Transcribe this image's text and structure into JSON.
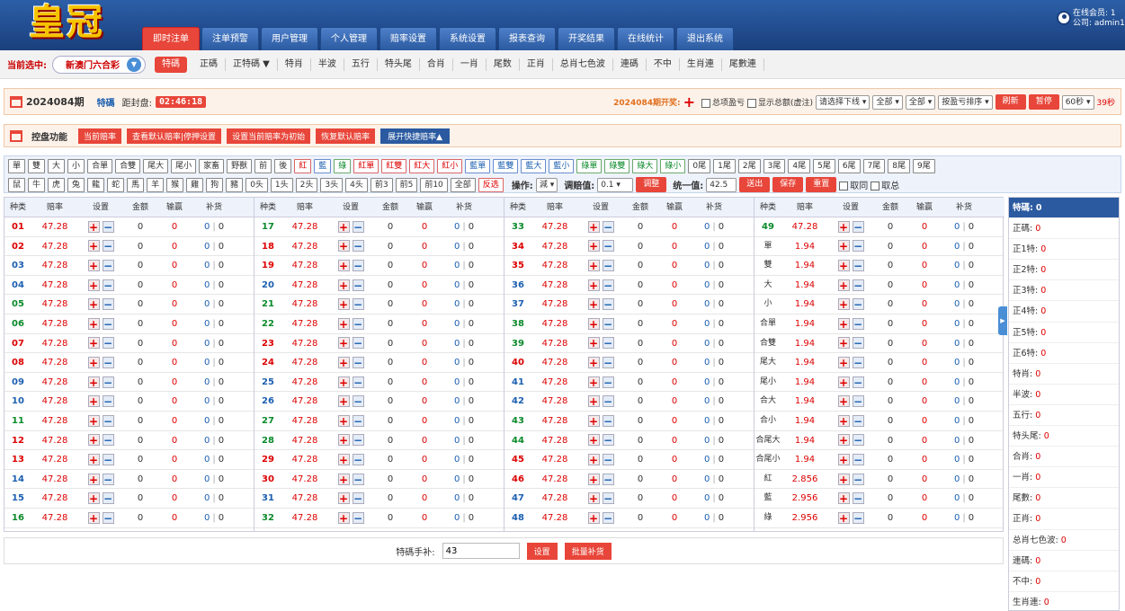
{
  "header": {
    "logo": "皇冠",
    "online_members": "在线会员: 1",
    "company": "公司: admin1",
    "nav": [
      "即时注单",
      "注单预警",
      "用户管理",
      "个人管理",
      "赔率设置",
      "系统设置",
      "报表查询",
      "开奖结果",
      "在线统计",
      "退出系统"
    ]
  },
  "subnav": {
    "current_label": "当前选中:",
    "lottery": "新澳门六合彩",
    "items": [
      "特碼",
      "正碼",
      "正特碼 ▼",
      "特肖",
      "半波",
      "五行",
      "特头尾",
      "合肖",
      "一肖",
      "尾数",
      "正肖",
      "总肖七色波",
      "連碼",
      "不中",
      "生肖連",
      "尾數連"
    ]
  },
  "infobar": {
    "period": "2024084期",
    "type": "特碼",
    "close_label": "距封盘:",
    "countdown": "02:46:18",
    "draw_label": "2024084期开奖:",
    "plus": "+",
    "chk_total": "总项盈亏",
    "chk_show": "显示总额(虚注)",
    "sel_line": "请选择下线",
    "sel_all1": "全部",
    "sel_all2": "全部",
    "sel_sort": "按盈亏排序",
    "refresh": "刷新",
    "pause": "暂停",
    "interval": "60秒",
    "seconds": "39秒"
  },
  "ctlbar": {
    "label": "控盘功能",
    "b1": "当前赔率",
    "b2": "查看默认赔率|停押设置",
    "b3": "设置当前赔率为初始",
    "b4": "恢复默认赔率",
    "b5": "展开快捷赔率▲"
  },
  "quick": {
    "row1": [
      "單",
      "雙",
      "大",
      "小",
      "合單",
      "合雙",
      "尾大",
      "尾小",
      "家畜",
      "野獸",
      "前",
      "後",
      "紅",
      "藍",
      "綠",
      "紅單",
      "紅雙",
      "紅大",
      "紅小",
      "藍單",
      "藍雙",
      "藍大",
      "藍小",
      "綠單",
      "綠雙",
      "綠大",
      "綠小",
      "0尾",
      "1尾",
      "2尾",
      "3尾",
      "4尾",
      "5尾",
      "6尾",
      "7尾",
      "8尾",
      "9尾"
    ],
    "row2": [
      "鼠",
      "牛",
      "虎",
      "兔",
      "龍",
      "蛇",
      "馬",
      "羊",
      "猴",
      "雞",
      "狗",
      "豬",
      "0头",
      "1头",
      "2头",
      "3头",
      "4头",
      "前3",
      "前5",
      "前10",
      "全部",
      "反选"
    ],
    "op_label": "操作:",
    "op": "減",
    "adj_label": "调赔值:",
    "adj": "0.1",
    "adjust": "调整",
    "uni_label": "统一值:",
    "uni": "42.5",
    "send": "送出",
    "save": "保存",
    "reset": "重置",
    "take_same": "取同",
    "take_total": "取总"
  },
  "table": {
    "headers": [
      "种类",
      "赔率",
      "设置",
      "金额",
      "输赢",
      "补货"
    ],
    "plus": "+",
    "minus": "−",
    "sep": "|",
    "columns": [
      [
        {
          "n": "01",
          "o": "47.28",
          "c": "red"
        },
        {
          "n": "02",
          "o": "47.28",
          "c": "red"
        },
        {
          "n": "03",
          "o": "47.28",
          "c": "blue"
        },
        {
          "n": "04",
          "o": "47.28",
          "c": "blue"
        },
        {
          "n": "05",
          "o": "47.28",
          "c": "green"
        },
        {
          "n": "06",
          "o": "47.28",
          "c": "green"
        },
        {
          "n": "07",
          "o": "47.28",
          "c": "red"
        },
        {
          "n": "08",
          "o": "47.28",
          "c": "red"
        },
        {
          "n": "09",
          "o": "47.28",
          "c": "blue"
        },
        {
          "n": "10",
          "o": "47.28",
          "c": "blue"
        },
        {
          "n": "11",
          "o": "47.28",
          "c": "green"
        },
        {
          "n": "12",
          "o": "47.28",
          "c": "red"
        },
        {
          "n": "13",
          "o": "47.28",
          "c": "red"
        },
        {
          "n": "14",
          "o": "47.28",
          "c": "blue"
        },
        {
          "n": "15",
          "o": "47.28",
          "c": "blue"
        },
        {
          "n": "16",
          "o": "47.28",
          "c": "green"
        }
      ],
      [
        {
          "n": "17",
          "o": "47.28",
          "c": "green"
        },
        {
          "n": "18",
          "o": "47.28",
          "c": "red"
        },
        {
          "n": "19",
          "o": "47.28",
          "c": "red"
        },
        {
          "n": "20",
          "o": "47.28",
          "c": "blue"
        },
        {
          "n": "21",
          "o": "47.28",
          "c": "green"
        },
        {
          "n": "22",
          "o": "47.28",
          "c": "green"
        },
        {
          "n": "23",
          "o": "47.28",
          "c": "red"
        },
        {
          "n": "24",
          "o": "47.28",
          "c": "red"
        },
        {
          "n": "25",
          "o": "47.28",
          "c": "blue"
        },
        {
          "n": "26",
          "o": "47.28",
          "c": "blue"
        },
        {
          "n": "27",
          "o": "47.28",
          "c": "green"
        },
        {
          "n": "28",
          "o": "47.28",
          "c": "green"
        },
        {
          "n": "29",
          "o": "47.28",
          "c": "red"
        },
        {
          "n": "30",
          "o": "47.28",
          "c": "red"
        },
        {
          "n": "31",
          "o": "47.28",
          "c": "blue"
        },
        {
          "n": "32",
          "o": "47.28",
          "c": "green"
        }
      ],
      [
        {
          "n": "33",
          "o": "47.28",
          "c": "green"
        },
        {
          "n": "34",
          "o": "47.28",
          "c": "red"
        },
        {
          "n": "35",
          "o": "47.28",
          "c": "red"
        },
        {
          "n": "36",
          "o": "47.28",
          "c": "blue"
        },
        {
          "n": "37",
          "o": "47.28",
          "c": "blue"
        },
        {
          "n": "38",
          "o": "47.28",
          "c": "green"
        },
        {
          "n": "39",
          "o": "47.28",
          "c": "green"
        },
        {
          "n": "40",
          "o": "47.28",
          "c": "red"
        },
        {
          "n": "41",
          "o": "47.28",
          "c": "blue"
        },
        {
          "n": "42",
          "o": "47.28",
          "c": "blue"
        },
        {
          "n": "43",
          "o": "47.28",
          "c": "green"
        },
        {
          "n": "44",
          "o": "47.28",
          "c": "green"
        },
        {
          "n": "45",
          "o": "47.28",
          "c": "red"
        },
        {
          "n": "46",
          "o": "47.28",
          "c": "red"
        },
        {
          "n": "47",
          "o": "47.28",
          "c": "blue"
        },
        {
          "n": "48",
          "o": "47.28",
          "c": "blue"
        }
      ],
      [
        {
          "n": "49",
          "o": "47.28",
          "c": "green"
        },
        {
          "n": "單",
          "o": "1.94",
          "c": "dark"
        },
        {
          "n": "雙",
          "o": "1.94",
          "c": "dark"
        },
        {
          "n": "大",
          "o": "1.94",
          "c": "dark"
        },
        {
          "n": "小",
          "o": "1.94",
          "c": "dark"
        },
        {
          "n": "合單",
          "o": "1.94",
          "c": "dark"
        },
        {
          "n": "合雙",
          "o": "1.94",
          "c": "dark"
        },
        {
          "n": "尾大",
          "o": "1.94",
          "c": "dark"
        },
        {
          "n": "尾小",
          "o": "1.94",
          "c": "dark"
        },
        {
          "n": "合大",
          "o": "1.94",
          "c": "dark"
        },
        {
          "n": "合小",
          "o": "1.94",
          "c": "dark"
        },
        {
          "n": "合尾大",
          "o": "1.94",
          "c": "dark"
        },
        {
          "n": "合尾小",
          "o": "1.94",
          "c": "dark"
        },
        {
          "n": "紅",
          "o": "2.856",
          "c": "dark"
        },
        {
          "n": "藍",
          "o": "2.956",
          "c": "dark"
        },
        {
          "n": "綠",
          "o": "2.956",
          "c": "dark"
        }
      ]
    ]
  },
  "bottom": {
    "label": "特碼手补:",
    "value": "43",
    "set": "设置",
    "batch": "批量补货"
  },
  "side": [
    {
      "l": "特碼:",
      "v": "0"
    },
    {
      "l": "正碼:",
      "v": "0"
    },
    {
      "l": "正1特:",
      "v": "0"
    },
    {
      "l": "正2特:",
      "v": "0"
    },
    {
      "l": "正3特:",
      "v": "0"
    },
    {
      "l": "正4特:",
      "v": "0"
    },
    {
      "l": "正5特:",
      "v": "0"
    },
    {
      "l": "正6特:",
      "v": "0"
    },
    {
      "l": "特肖:",
      "v": "0"
    },
    {
      "l": "半波:",
      "v": "0"
    },
    {
      "l": "五行:",
      "v": "0"
    },
    {
      "l": "特头尾:",
      "v": "0"
    },
    {
      "l": "合肖:",
      "v": "0"
    },
    {
      "l": "一肖:",
      "v": "0"
    },
    {
      "l": "尾數:",
      "v": "0"
    },
    {
      "l": "正肖:",
      "v": "0"
    },
    {
      "l": "总肖七色波:",
      "v": "0"
    },
    {
      "l": "連碼:",
      "v": "0"
    },
    {
      "l": "不中:",
      "v": "0"
    },
    {
      "l": "生肖連:",
      "v": "0"
    }
  ],
  "colors": {
    "red": "#d00",
    "blue": "#1c5fb0",
    "green": "#0a8a2a",
    "dark": "#333"
  }
}
